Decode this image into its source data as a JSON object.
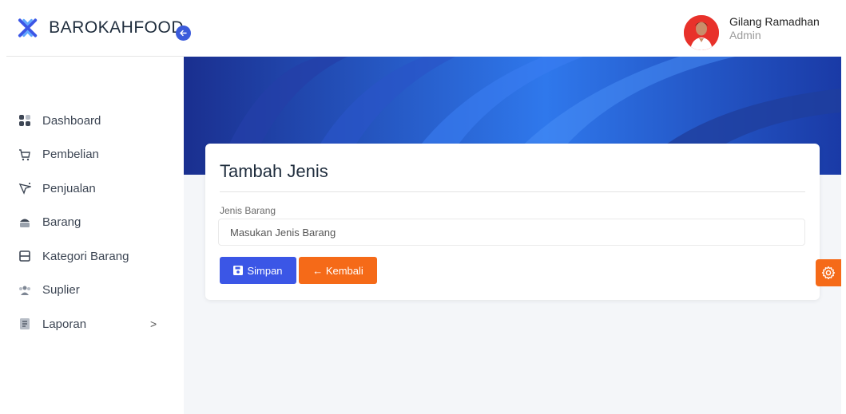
{
  "brand": {
    "name": "BAROKAHFOOD"
  },
  "sidebar": {
    "items": [
      {
        "label": "Dashboard",
        "icon": "dashboard-icon"
      },
      {
        "label": "Pembelian",
        "icon": "cart-icon"
      },
      {
        "label": "Penjualan",
        "icon": "sales-icon"
      },
      {
        "label": "Barang",
        "icon": "box-icon"
      },
      {
        "label": "Kategori Barang",
        "icon": "category-icon"
      },
      {
        "label": "Suplier",
        "icon": "users-icon"
      },
      {
        "label": "Laporan",
        "icon": "report-icon",
        "chevron": ">"
      }
    ]
  },
  "user": {
    "name": "Gilang Ramadhan",
    "role": "Admin"
  },
  "form": {
    "title": "Tambah Jenis",
    "field_label": "Jenis Barang",
    "field_placeholder": "Masukan Jenis Barang",
    "field_value": "",
    "save_label": "Simpan",
    "back_label": "← Kembali"
  },
  "colors": {
    "primary": "#3b56e6",
    "accent": "#f56a18",
    "hero": "#1d4fd8"
  }
}
